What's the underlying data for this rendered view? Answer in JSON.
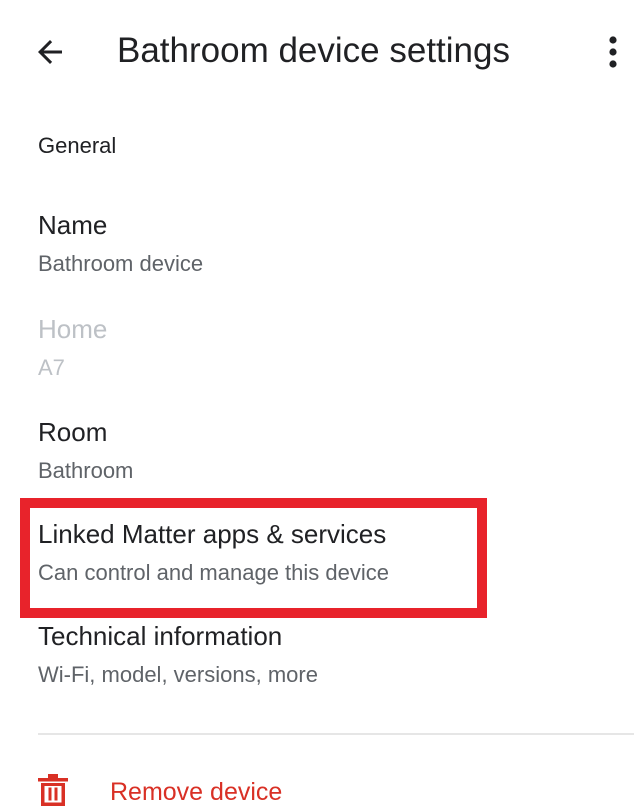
{
  "header": {
    "title": "Bathroom device settings",
    "back_icon": "arrow-back-icon",
    "menu_icon": "more-vert-icon"
  },
  "general": {
    "section_label": "General",
    "rows": {
      "name": {
        "title": "Name",
        "subtitle": "Bathroom device",
        "enabled": true
      },
      "home": {
        "title": "Home",
        "subtitle": "A7",
        "enabled": false
      },
      "room": {
        "title": "Room",
        "subtitle": "Bathroom",
        "enabled": true
      },
      "linked": {
        "title": "Linked Matter apps & services",
        "subtitle": "Can control and manage this device",
        "enabled": true,
        "highlighted": true
      },
      "technical": {
        "title": "Technical information",
        "subtitle": "Wi-Fi, model, versions, more",
        "enabled": true
      }
    }
  },
  "footer": {
    "remove_label": "Remove device",
    "remove_icon": "trash-icon"
  },
  "colors": {
    "text_primary": "#202124",
    "text_secondary": "#5f6368",
    "text_disabled": "#bdc1c6",
    "danger": "#d93025",
    "highlight": "#e8232b"
  }
}
